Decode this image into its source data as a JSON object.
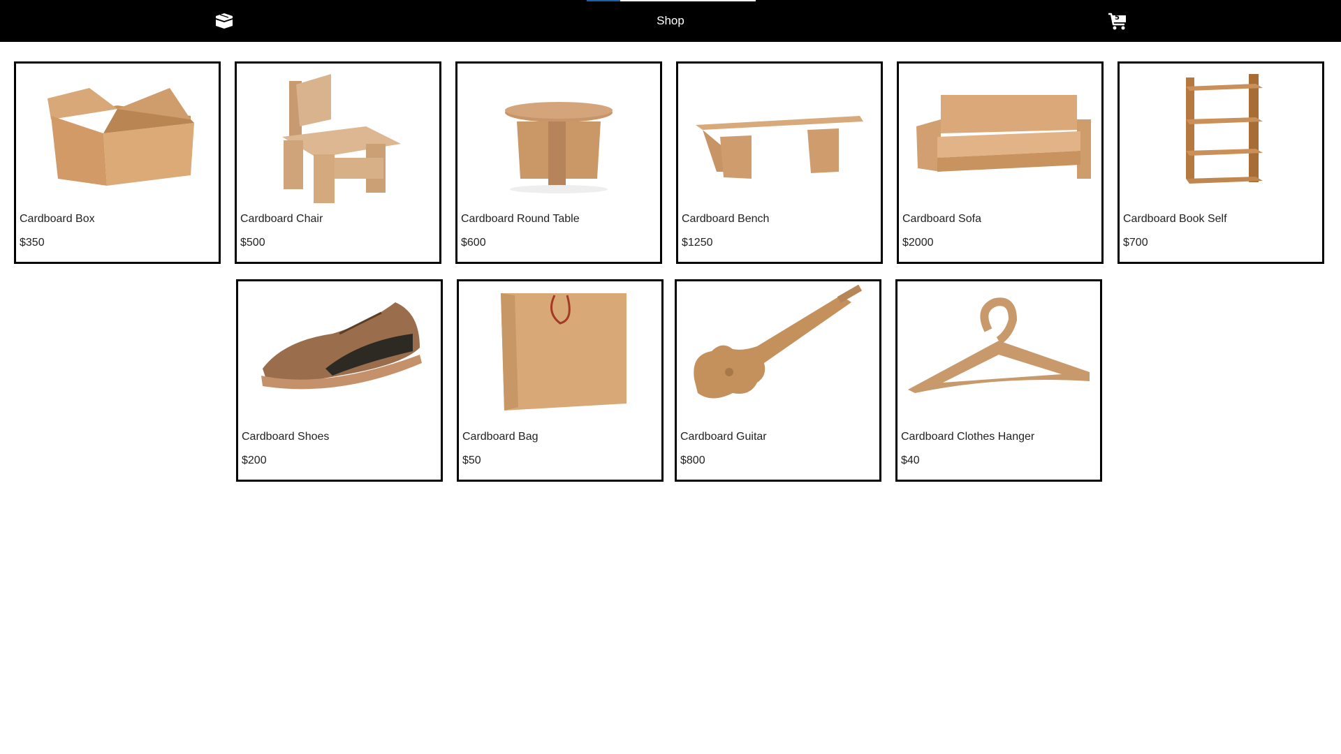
{
  "header": {
    "title": "Shop",
    "logo_icon": "box-icon",
    "cart_icon": "shopping-cart-icon",
    "cart_count": "5",
    "accent_color": "#1b5fa8"
  },
  "products": [
    {
      "name": "Cardboard Box",
      "price": "$350",
      "icon": "cardboard-box-image"
    },
    {
      "name": "Cardboard Chair",
      "price": "$500",
      "icon": "cardboard-chair-image"
    },
    {
      "name": "Cardboard Round Table",
      "price": "$600",
      "icon": "cardboard-table-image"
    },
    {
      "name": "Cardboard Bench",
      "price": "$1250",
      "icon": "cardboard-bench-image"
    },
    {
      "name": "Cardboard Sofa",
      "price": "$2000",
      "icon": "cardboard-sofa-image"
    },
    {
      "name": "Cardboard Book Self",
      "price": "$700",
      "icon": "cardboard-shelf-image"
    },
    {
      "name": "Cardboard Shoes",
      "price": "$200",
      "icon": "cardboard-shoes-image"
    },
    {
      "name": "Cardboard Bag",
      "price": "$50",
      "icon": "cardboard-bag-image"
    },
    {
      "name": "Cardboard Guitar",
      "price": "$800",
      "icon": "cardboard-guitar-image"
    },
    {
      "name": "Cardboard Clothes Hanger",
      "price": "$40",
      "icon": "cardboard-hanger-image"
    }
  ]
}
